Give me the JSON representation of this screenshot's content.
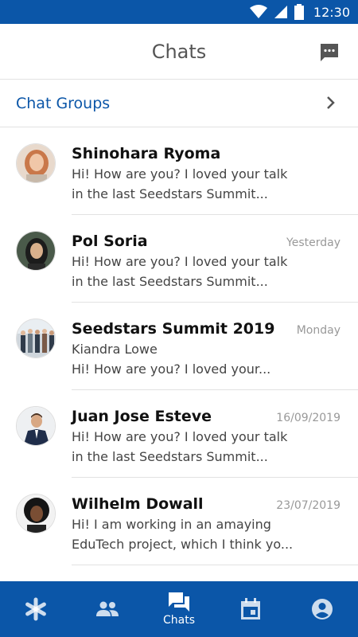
{
  "status_bar": {
    "time": "12:30"
  },
  "header": {
    "title": "Chats"
  },
  "chat_groups": {
    "label": "Chat Groups"
  },
  "chats": [
    {
      "name": "Shinohara Ryoma",
      "time": "",
      "line1": "Hi! How are you? I loved your talk",
      "line2": "in the last Seedstars Summit..."
    },
    {
      "name": "Pol Soria",
      "time": "Yesterday",
      "line1": "Hi! How are you? I loved your talk",
      "line2": "in the last Seedstars Summit..."
    },
    {
      "name": "Seedstars Summit 2019",
      "time": "Monday",
      "line1": "Kiandra Lowe",
      "line2": "Hi! How are you? I loved your..."
    },
    {
      "name": "Juan Jose Esteve",
      "time": "16/09/2019",
      "line1": "Hi! How are you? I loved your talk",
      "line2": "in the last Seedstars Summit..."
    },
    {
      "name": "Wilhelm Dowall",
      "time": "23/07/2019",
      "line1": "Hi! I am working in an amaying",
      "line2": "EduTech project, which I think yo..."
    }
  ],
  "bottom_nav": {
    "items": [
      {
        "icon": "asterisk-icon",
        "label": ""
      },
      {
        "icon": "people-icon",
        "label": ""
      },
      {
        "icon": "chats-icon",
        "label": "Chats"
      },
      {
        "icon": "calendar-icon",
        "label": ""
      },
      {
        "icon": "profile-icon",
        "label": ""
      }
    ]
  },
  "colors": {
    "primary": "#0b56a8",
    "divider": "#e2e2e2",
    "muted": "#999999"
  }
}
